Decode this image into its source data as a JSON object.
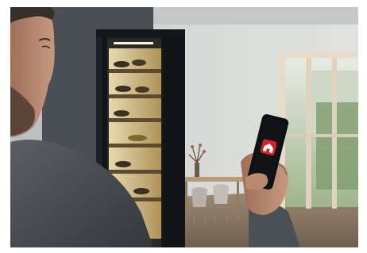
{
  "scene": {
    "subject": "man-holding-smartphone",
    "appliance": "wine-cabinet",
    "background": "dining-room-with-window"
  },
  "phone": {
    "app_icon": "house-icon",
    "app_icon_color": "#d3232a",
    "screen_color": "#121317"
  },
  "colors": {
    "cabinet": "#1d1f23",
    "shelf_light": "#f2e4b8",
    "wall": "#d9dcd9",
    "window_frame": "#e6dccb",
    "floor": "#8a7a67",
    "sweater": "#454b50",
    "skin": "#b8876e"
  }
}
